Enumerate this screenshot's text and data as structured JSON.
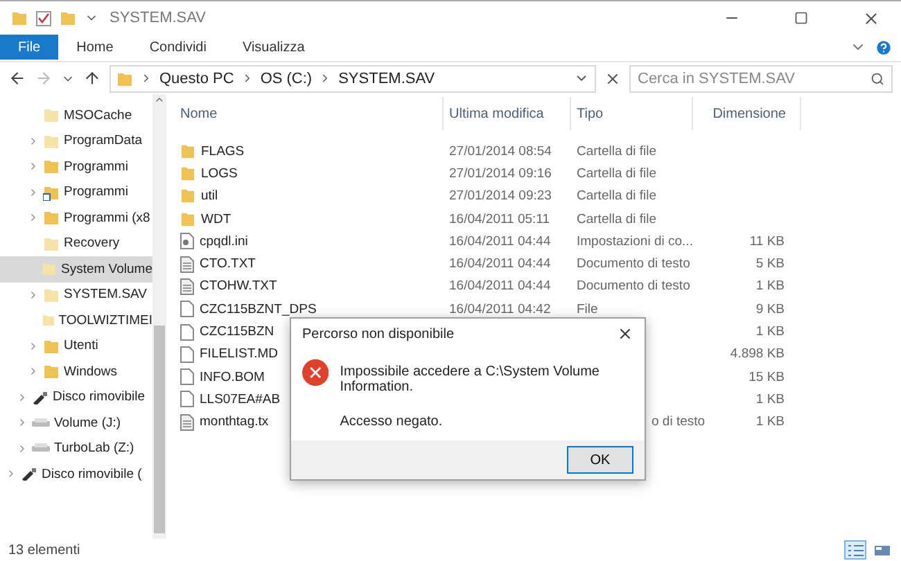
{
  "window": {
    "title": "SYSTEM.SAV"
  },
  "ribbon": {
    "tabs": [
      {
        "label": "File",
        "selected": true
      },
      {
        "label": "Home",
        "selected": false
      },
      {
        "label": "Condividi",
        "selected": false
      },
      {
        "label": "Visualizza",
        "selected": false
      }
    ]
  },
  "address": {
    "crumbs": [
      "Questo PC",
      "OS (C:)",
      "SYSTEM.SAV"
    ],
    "search_placeholder": "Cerca in SYSTEM.SAV"
  },
  "nav": {
    "tree": [
      {
        "children": [
          {
            "children": [
              {
                "label": "MSOCache",
                "kind": "hidden-folder",
                "expandable": false,
                "selected": false
              },
              {
                "label": "ProgramData",
                "kind": "hidden-folder",
                "expandable": true,
                "selected": false
              },
              {
                "label": "Programmi",
                "kind": "folder",
                "expandable": true,
                "selected": false
              },
              {
                "label": "Programmi",
                "kind": "linked-folder",
                "expandable": true,
                "selected": false
              },
              {
                "label": "Programmi (x8",
                "kind": "folder",
                "expandable": true,
                "selected": false
              },
              {
                "label": "Recovery",
                "kind": "hidden-folder",
                "expandable": false,
                "selected": false
              },
              {
                "label": "System Volume",
                "kind": "hidden-folder",
                "expandable": false,
                "selected": true
              },
              {
                "label": "SYSTEM.SAV",
                "kind": "hidden-folder",
                "expandable": true,
                "selected": false
              },
              {
                "label": "TOOLWIZTIMEI",
                "kind": "hidden-folder",
                "expandable": false,
                "selected": false
              },
              {
                "label": "Utenti",
                "kind": "folder",
                "expandable": true,
                "selected": false
              },
              {
                "label": "Windows",
                "kind": "folder",
                "expandable": true,
                "selected": false
              }
            ]
          },
          {
            "label": "Disco rimovibile",
            "kind": "usb",
            "expandable": true,
            "selected": false
          },
          {
            "label": "Volume (J:)",
            "kind": "drive",
            "expandable": true,
            "selected": false
          },
          {
            "label": "TurboLab (Z:)",
            "kind": "drive",
            "expandable": true,
            "selected": false
          }
        ]
      },
      {
        "label": "Disco rimovibile (",
        "kind": "usb",
        "expandable": true,
        "selected": false
      }
    ]
  },
  "table": {
    "columns": [
      "Nome",
      "Ultima modifica",
      "Tipo",
      "Dimensione"
    ],
    "rows": [
      {
        "kind": "folder",
        "name": "FLAGS",
        "modified": "27/01/2014 08:54",
        "type": "Cartella di file",
        "size": ""
      },
      {
        "kind": "folder",
        "name": "LOGS",
        "modified": "27/01/2014 09:16",
        "type": "Cartella di file",
        "size": ""
      },
      {
        "kind": "folder",
        "name": "util",
        "modified": "27/01/2014 09:23",
        "type": "Cartella di file",
        "size": ""
      },
      {
        "kind": "folder",
        "name": "WDT",
        "modified": "16/04/2011 05:11",
        "type": "Cartella di file",
        "size": ""
      },
      {
        "kind": "settings",
        "name": "cpqdl.ini",
        "modified": "16/04/2011 04:44",
        "type": "Impostazioni di co...",
        "size": "11 KB"
      },
      {
        "kind": "text",
        "name": "CTO.TXT",
        "modified": "16/04/2011 04:44",
        "type": "Documento di testo",
        "size": "5 KB"
      },
      {
        "kind": "text",
        "name": "CTOHW.TXT",
        "modified": "16/04/2011 04:44",
        "type": "Documento di testo",
        "size": "1 KB"
      },
      {
        "kind": "file",
        "name": "CZC115BZNT_DPS",
        "modified": "16/04/2011 04:42",
        "type": "File",
        "size": "9 KB"
      },
      {
        "kind": "file",
        "name": "CZC115BZN",
        "modified": "",
        "type": "",
        "size": "1 KB"
      },
      {
        "kind": "file",
        "name": "FILELIST.MD",
        "modified": "",
        "type": "",
        "size": "4.898 KB"
      },
      {
        "kind": "file",
        "name": "INFO.BOM",
        "modified": "",
        "type": "",
        "size": "15 KB"
      },
      {
        "kind": "file",
        "name": "LLS07EA#AB",
        "modified": "",
        "type": "",
        "size": "1 KB"
      },
      {
        "kind": "text",
        "name": "monthtag.tx",
        "modified": "",
        "type": "o di testo",
        "size": "1 KB"
      }
    ]
  },
  "dialog": {
    "title": "Percorso non disponibile",
    "message": "Impossibile accedere a C:\\System Volume Information.",
    "detail": "Accesso negato.",
    "button": "OK"
  },
  "status_bar": {
    "count": "13 elementi",
    "views": [
      {
        "kind": "details",
        "selected": true
      },
      {
        "kind": "tiles",
        "selected": false
      }
    ]
  }
}
